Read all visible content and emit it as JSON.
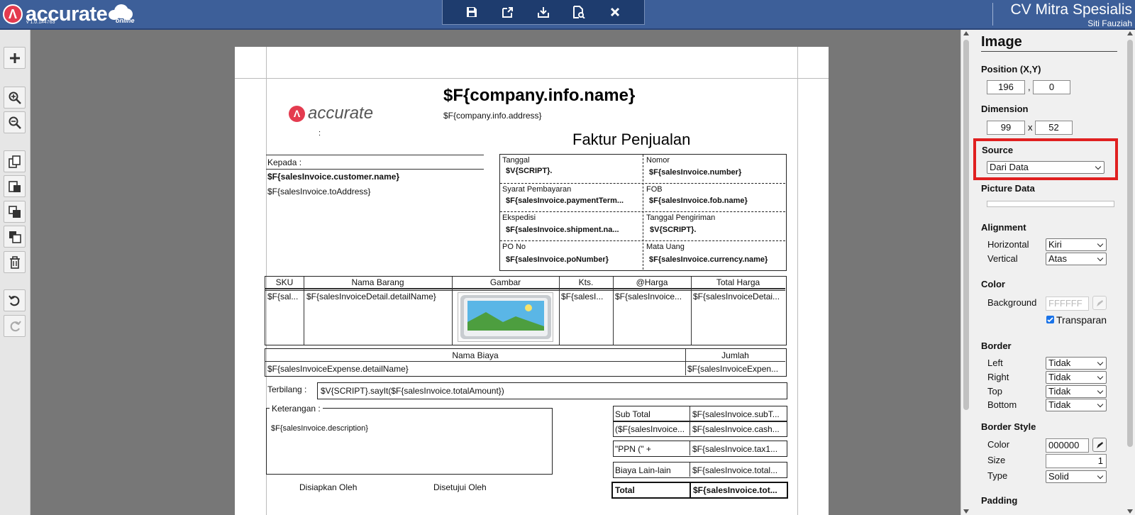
{
  "app": {
    "brand": "accurate",
    "brand_sub": "online",
    "version": "v 1.0.1#4763",
    "company": "CV Mitra Spesialis",
    "user": "Siti Fauziah"
  },
  "toolbar": [
    "save-icon",
    "export-icon",
    "download-icon",
    "preview-icon",
    "close-icon"
  ],
  "left_tools": [
    "add-icon",
    "zoom-in-icon",
    "zoom-out-icon",
    "copy-icon",
    "paste-icon",
    "bring-front-icon",
    "send-back-icon",
    "delete-icon",
    "undo-icon",
    "redo-icon"
  ],
  "report": {
    "logo_text": "accurate",
    "logo_colon": ":",
    "company_name": "$F{company.info.name}",
    "company_address": "$F{company.info.address}",
    "title": "Faktur Penjualan",
    "kepada_label": "Kepada :",
    "customer_name": "$F{salesInvoice.customer.name}",
    "to_address": "$F{salesInvoice.toAddress}",
    "info": [
      {
        "label": "Tanggal",
        "value": "$V{SCRIPT}."
      },
      {
        "label": "Nomor",
        "value": "$F{salesInvoice.number}"
      },
      {
        "label": "Syarat Pembayaran",
        "value": "$F{salesInvoice.paymentTerm..."
      },
      {
        "label": "FOB",
        "value": "$F{salesInvoice.fob.name}"
      },
      {
        "label": "Ekspedisi",
        "value": "$F{salesInvoice.shipment.na..."
      },
      {
        "label": "Tanggal Pengiriman",
        "value": "$V{SCRIPT}."
      },
      {
        "label": "PO No",
        "value": "$F{salesInvoice.poNumber}"
      },
      {
        "label": "Mata Uang",
        "value": "$F{salesInvoice.currency.name}"
      }
    ],
    "detail_headers": [
      "SKU",
      "Nama Barang",
      "Gambar",
      "Kts.",
      "@Harga",
      "Total Harga"
    ],
    "detail_row": [
      "$F{sal...",
      "$F{salesInvoiceDetail.detailName}",
      "",
      "$F{salesI...",
      "$F{salesInvoice...",
      "$F{salesInvoiceDetai..."
    ],
    "expense_headers": [
      "Nama Biaya",
      "Jumlah"
    ],
    "expense_row": [
      "$F{salesInvoiceExpense.detailName}",
      "$F{salesInvoiceExpen..."
    ],
    "terbilang_label": "Terbilang :",
    "terbilang_value": "$V{SCRIPT}.sayIt($F{salesInvoice.totalAmount})",
    "keterangan_label": "Keterangan :",
    "description": "$F{salesInvoice.description}",
    "prepared_by": "Disiapkan Oleh",
    "approved_by": "Disetujui Oleh",
    "totals": [
      {
        "label": "Sub Total",
        "value": "$F{salesInvoice.subT..."
      },
      {
        "label": "($F{salesInvoice...",
        "value": "$F{salesInvoice.cash..."
      },
      {
        "label": "\"PPN (\" +",
        "value": "$F{salesInvoice.tax1..."
      },
      {
        "label": "Biaya Lain-lain",
        "value": "$F{salesInvoice.total..."
      },
      {
        "label": "Total",
        "value": "$F{salesInvoice.tot..."
      }
    ]
  },
  "panel": {
    "title": "Image",
    "position_label": "Position (X,Y)",
    "pos_x": "196",
    "pos_sep": ",",
    "pos_y": "0",
    "dimension_label": "Dimension",
    "dim_w": "99",
    "dim_sep": "x",
    "dim_h": "52",
    "source_label": "Source",
    "source_value": "Dari Data",
    "picture_data_label": "Picture Data",
    "alignment_label": "Alignment",
    "horizontal_label": "Horizontal",
    "horizontal_value": "Kiri",
    "vertical_label": "Vertical",
    "vertical_value": "Atas",
    "color_label": "Color",
    "background_label": "Background",
    "background_value": "FFFFFF",
    "transparan_label": "Transparan",
    "border_label": "Border",
    "left_label": "Left",
    "left_value": "Tidak",
    "right_label": "Right",
    "right_value": "Tidak",
    "top_label": "Top",
    "top_value": "Tidak",
    "bottom_label": "Bottom",
    "bottom_value": "Tidak",
    "border_style_label": "Border Style",
    "bs_color_label": "Color",
    "bs_color_value": "000000",
    "size_label": "Size",
    "size_value": "1",
    "type_label": "Type",
    "type_value": "Solid",
    "padding_label": "Padding"
  },
  "colors": {
    "topbar": "#3d5f99",
    "highlight": "#e02020",
    "brand_red": "#e43b4f"
  }
}
